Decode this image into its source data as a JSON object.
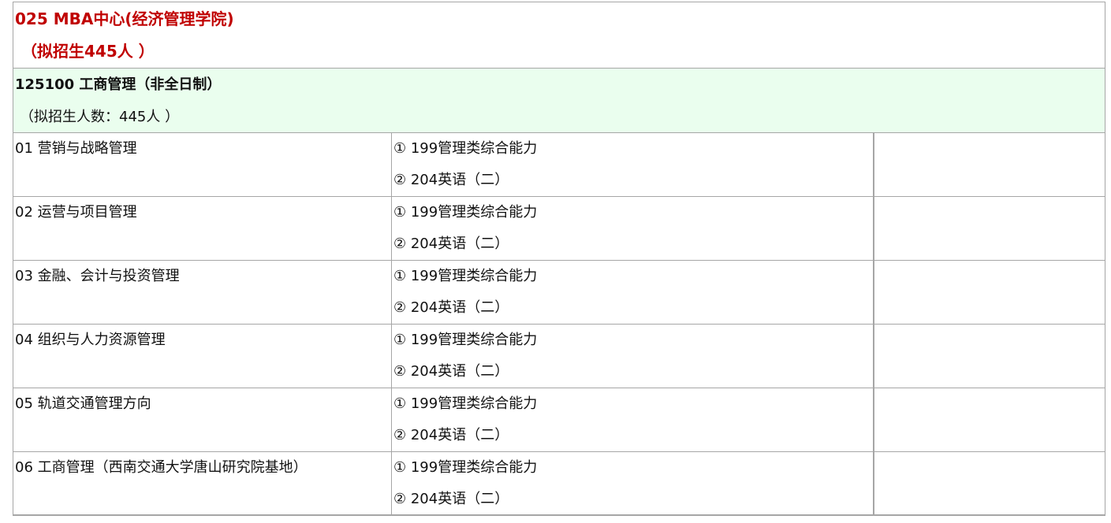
{
  "department": {
    "title": "025 MBA中心(经济管理学院)",
    "quota": "（拟招生445人 ）"
  },
  "major": {
    "title": "125100 工商管理（非全日制）",
    "quota": "（拟招生人数：445人 ）"
  },
  "directions": [
    {
      "name": "01 营销与战略管理",
      "exam1": "① 199管理类综合能力",
      "exam2": "② 204英语（二）"
    },
    {
      "name": "02 运营与项目管理",
      "exam1": "① 199管理类综合能力",
      "exam2": "② 204英语（二）"
    },
    {
      "name": "03 金融、会计与投资管理",
      "exam1": "① 199管理类综合能力",
      "exam2": "② 204英语（二）"
    },
    {
      "name": "04 组织与人力资源管理",
      "exam1": "① 199管理类综合能力",
      "exam2": "② 204英语（二）"
    },
    {
      "name": "05 轨道交通管理方向",
      "exam1": "① 199管理类综合能力",
      "exam2": "② 204英语（二）"
    },
    {
      "name": "06 工商管理（西南交通大学唐山研究院基地）",
      "exam1": "① 199管理类综合能力",
      "exam2": "② 204英语（二）"
    }
  ],
  "colors": {
    "department_text": "#c00000",
    "major_background": "#eafeee",
    "border": "#a6a6a6"
  }
}
